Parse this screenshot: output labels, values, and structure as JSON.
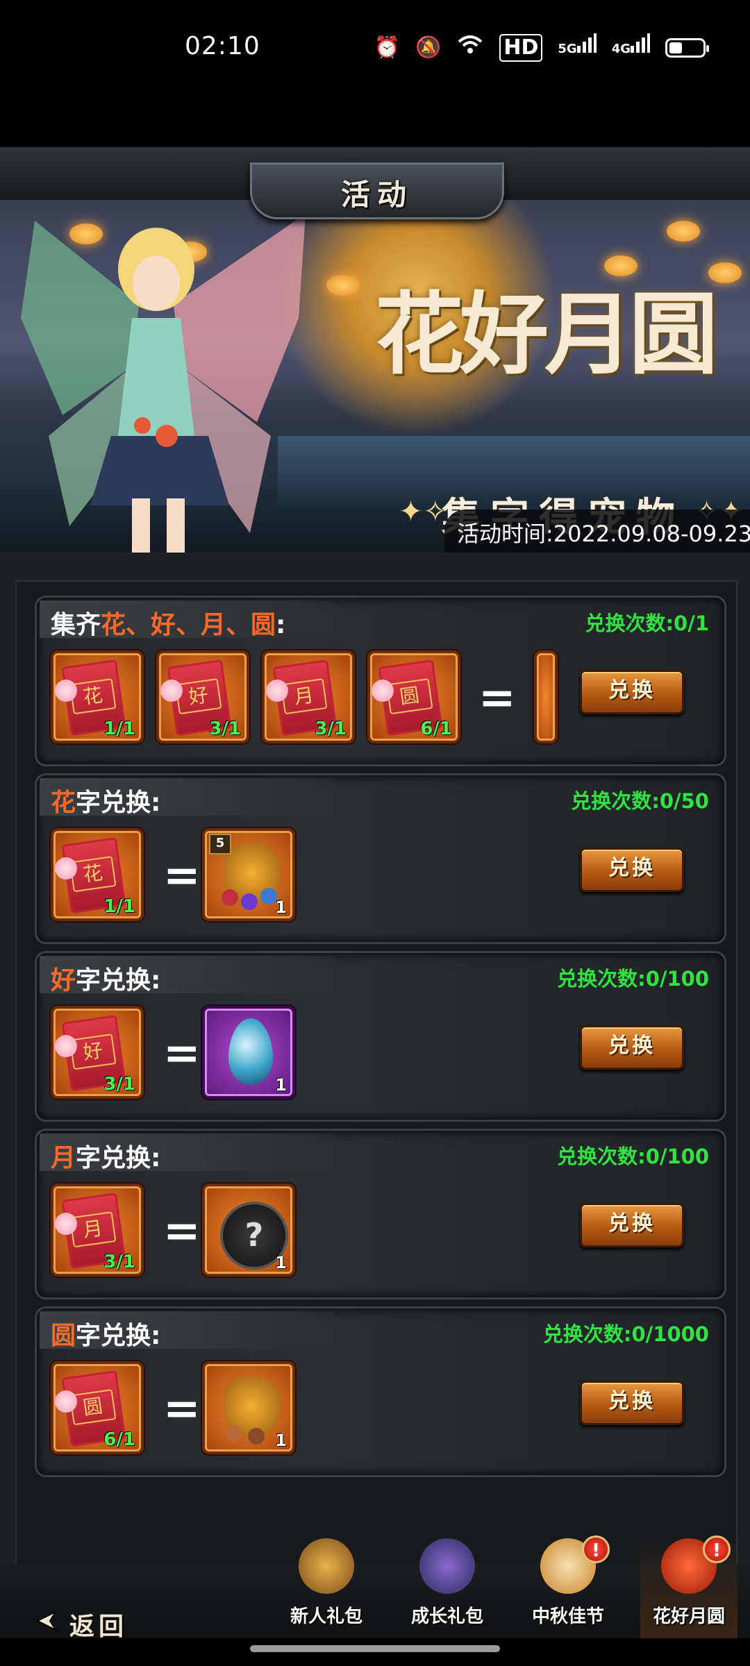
{
  "status_bar": {
    "time": "02:10",
    "icons": [
      "alarm-icon",
      "mute-icon",
      "wifi-icon",
      "hd-icon",
      "signal-5g-icon",
      "signal-4g-icon",
      "battery-icon"
    ],
    "hd_label": "HD",
    "net1": "5G",
    "net2": "4G"
  },
  "header": {
    "title": "活动"
  },
  "banner": {
    "title": "花好月圆",
    "subtitle": "集字得宠物",
    "time_label": "活动时间:2022.09.08-09.23"
  },
  "exchanges": [
    {
      "title_prefix": "集齐",
      "title_highlight": "花、好、月、圆",
      "title_suffix": ":",
      "count": "兑换次数:0/1",
      "inputs": [
        {
          "char": "花",
          "qty": "1/1"
        },
        {
          "char": "好",
          "qty": "3/1"
        },
        {
          "char": "月",
          "qty": "3/1"
        },
        {
          "char": "圆",
          "qty": "6/1"
        }
      ],
      "button": "兑换"
    },
    {
      "title_highlight": "花",
      "title_suffix": "字兑换:",
      "count": "兑换次数:0/50",
      "input": {
        "char": "花",
        "qty": "1/1"
      },
      "reward": {
        "type": "bag-gems",
        "level": "5",
        "qty": "1"
      },
      "button": "兑换"
    },
    {
      "title_highlight": "好",
      "title_suffix": "字兑换:",
      "count": "兑换次数:0/100",
      "input": {
        "char": "好",
        "qty": "3/1"
      },
      "reward": {
        "type": "crystal",
        "qty": "1"
      },
      "button": "兑换"
    },
    {
      "title_highlight": "月",
      "title_suffix": "字兑换:",
      "count": "兑换次数:0/100",
      "input": {
        "char": "月",
        "qty": "3/1"
      },
      "reward": {
        "type": "mystery",
        "symbol": "?",
        "qty": "1"
      },
      "button": "兑换"
    },
    {
      "title_highlight": "圆",
      "title_suffix": "字兑换:",
      "count": "兑换次数:0/1000",
      "input": {
        "char": "圆",
        "qty": "6/1"
      },
      "reward": {
        "type": "bag-coins",
        "qty": "1"
      },
      "button": "兑换"
    }
  ],
  "equals": "=",
  "bottom": {
    "back_label": "返回",
    "tabs": [
      {
        "label": "新人礼包",
        "badge": ""
      },
      {
        "label": "成长礼包",
        "badge": ""
      },
      {
        "label": "中秋佳节",
        "badge": "!"
      },
      {
        "label": "花好月圆",
        "badge": "!"
      }
    ]
  },
  "colors": {
    "highlight": "#ff6a2a",
    "count_green": "#30e340",
    "button_orange": "#b35a14"
  }
}
